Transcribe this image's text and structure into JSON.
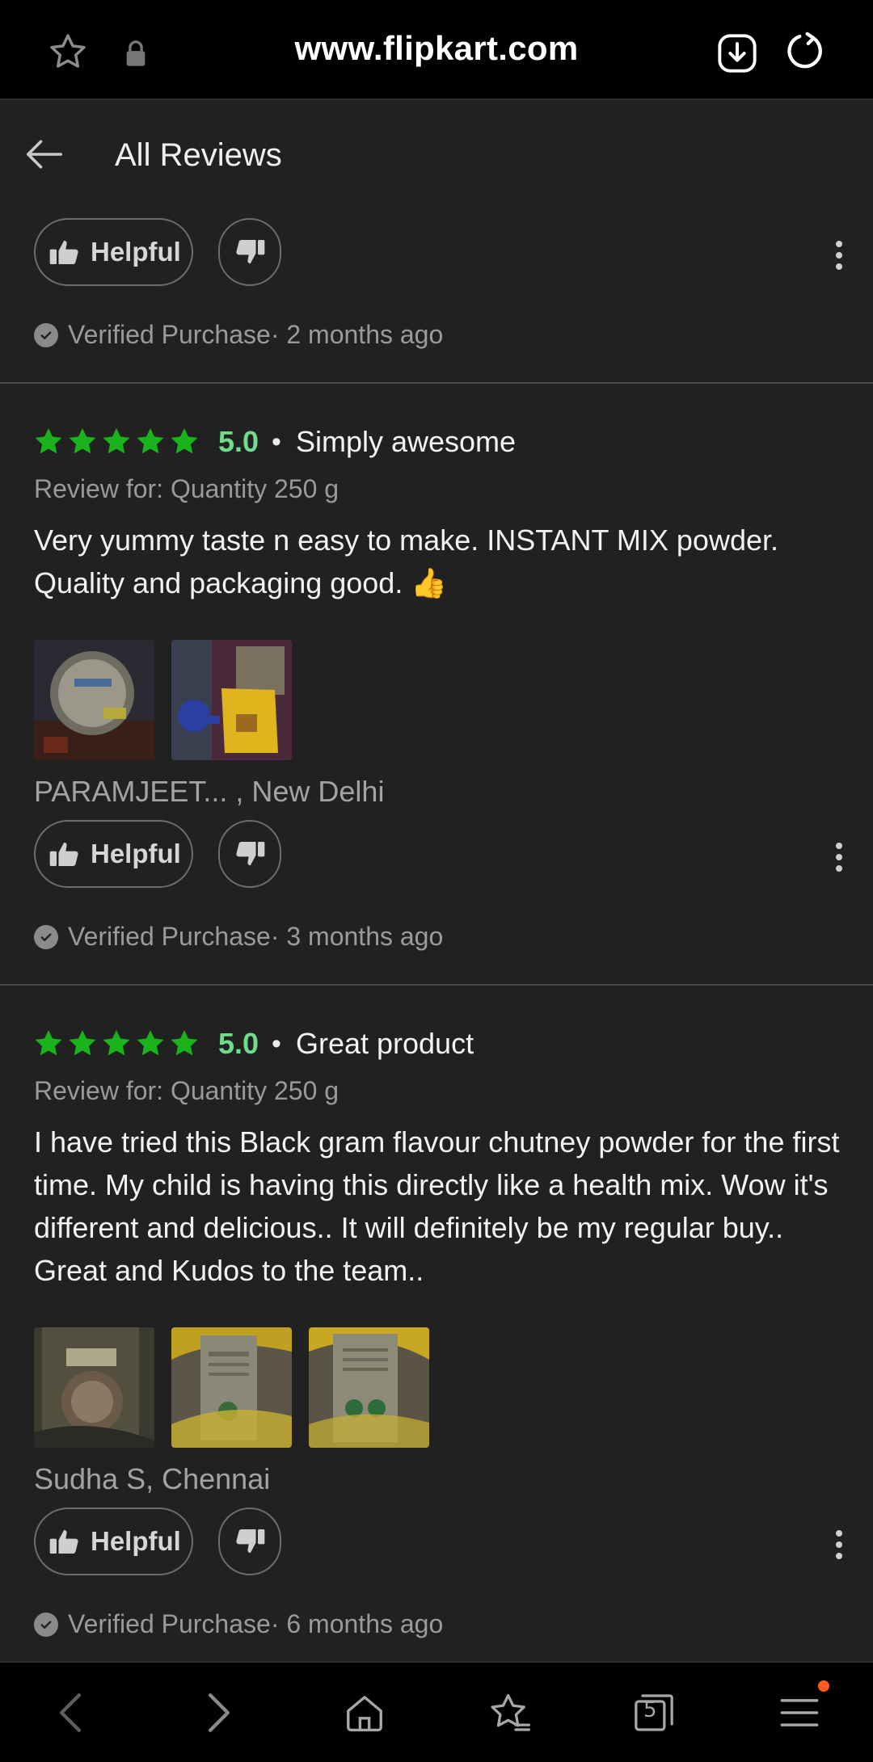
{
  "browser": {
    "url": "www.flipkart.com",
    "icons": [
      "star-outline-icon",
      "lock-icon",
      "download-icon",
      "reload-icon"
    ]
  },
  "header": {
    "title": "All Reviews"
  },
  "common": {
    "helpful_label": "Helpful"
  },
  "top_partial": {
    "verified": "Verified Purchase· 2 months ago"
  },
  "reviews": [
    {
      "rating": "5.0",
      "title": "Simply awesome",
      "variant": "Review for: Quantity 250 g",
      "body": "Very yummy taste n easy to make. INSTANT MIX powder. Quality and packaging good. 👍",
      "author": "PARAMJEET... , New Delhi",
      "verified": "Verified Purchase· 3 months ago",
      "photo_count": 2
    },
    {
      "rating": "5.0",
      "title": "Great product",
      "variant": "Review for: Quantity 250 g",
      "body": "I have tried this Black gram flavour chutney powder for the first time. My child is having this directly like a health mix. Wow it's different and delicious.. It will definitely be my regular buy.. Great and Kudos to the team..",
      "author": "Sudha S, Chennai",
      "verified": "Verified Purchase· 6 months ago",
      "photo_count": 3
    }
  ],
  "bottom_nav": {
    "tabs_count": "5",
    "icons": [
      "back-icon",
      "forward-icon",
      "home-icon",
      "bookmarks-icon",
      "tabs-icon",
      "menu-icon"
    ]
  },
  "colors": {
    "star": "#1bb31b",
    "score": "#6fdc8c",
    "notification": "#ff5a1f"
  }
}
